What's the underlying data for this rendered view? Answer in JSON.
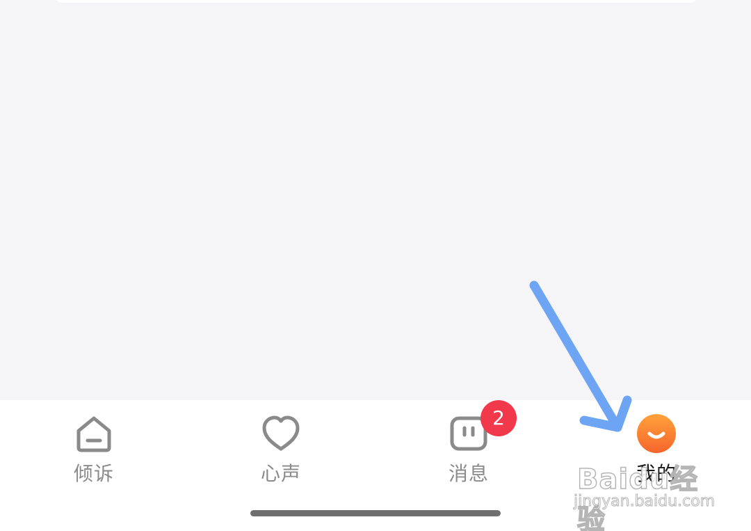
{
  "tabbar": {
    "tabs": [
      {
        "label": "倾诉",
        "icon": "home-icon",
        "active": false
      },
      {
        "label": "心声",
        "icon": "heart-icon",
        "active": false
      },
      {
        "label": "消息",
        "icon": "message-icon",
        "active": false,
        "badge": "2"
      },
      {
        "label": "我的",
        "icon": "profile-smile-icon",
        "active": true
      }
    ]
  },
  "colors": {
    "background": "#f5f5f7",
    "tabbar": "#ffffff",
    "icon_inactive": "#8a8a8a",
    "badge": "#f2384b",
    "profile_gradient_start": "#ffa23a",
    "profile_gradient_end": "#f5652d",
    "arrow": "#6ea4f4"
  },
  "watermark": {
    "logo": "Baidu经验",
    "url": "jingyan.baidu.com"
  }
}
